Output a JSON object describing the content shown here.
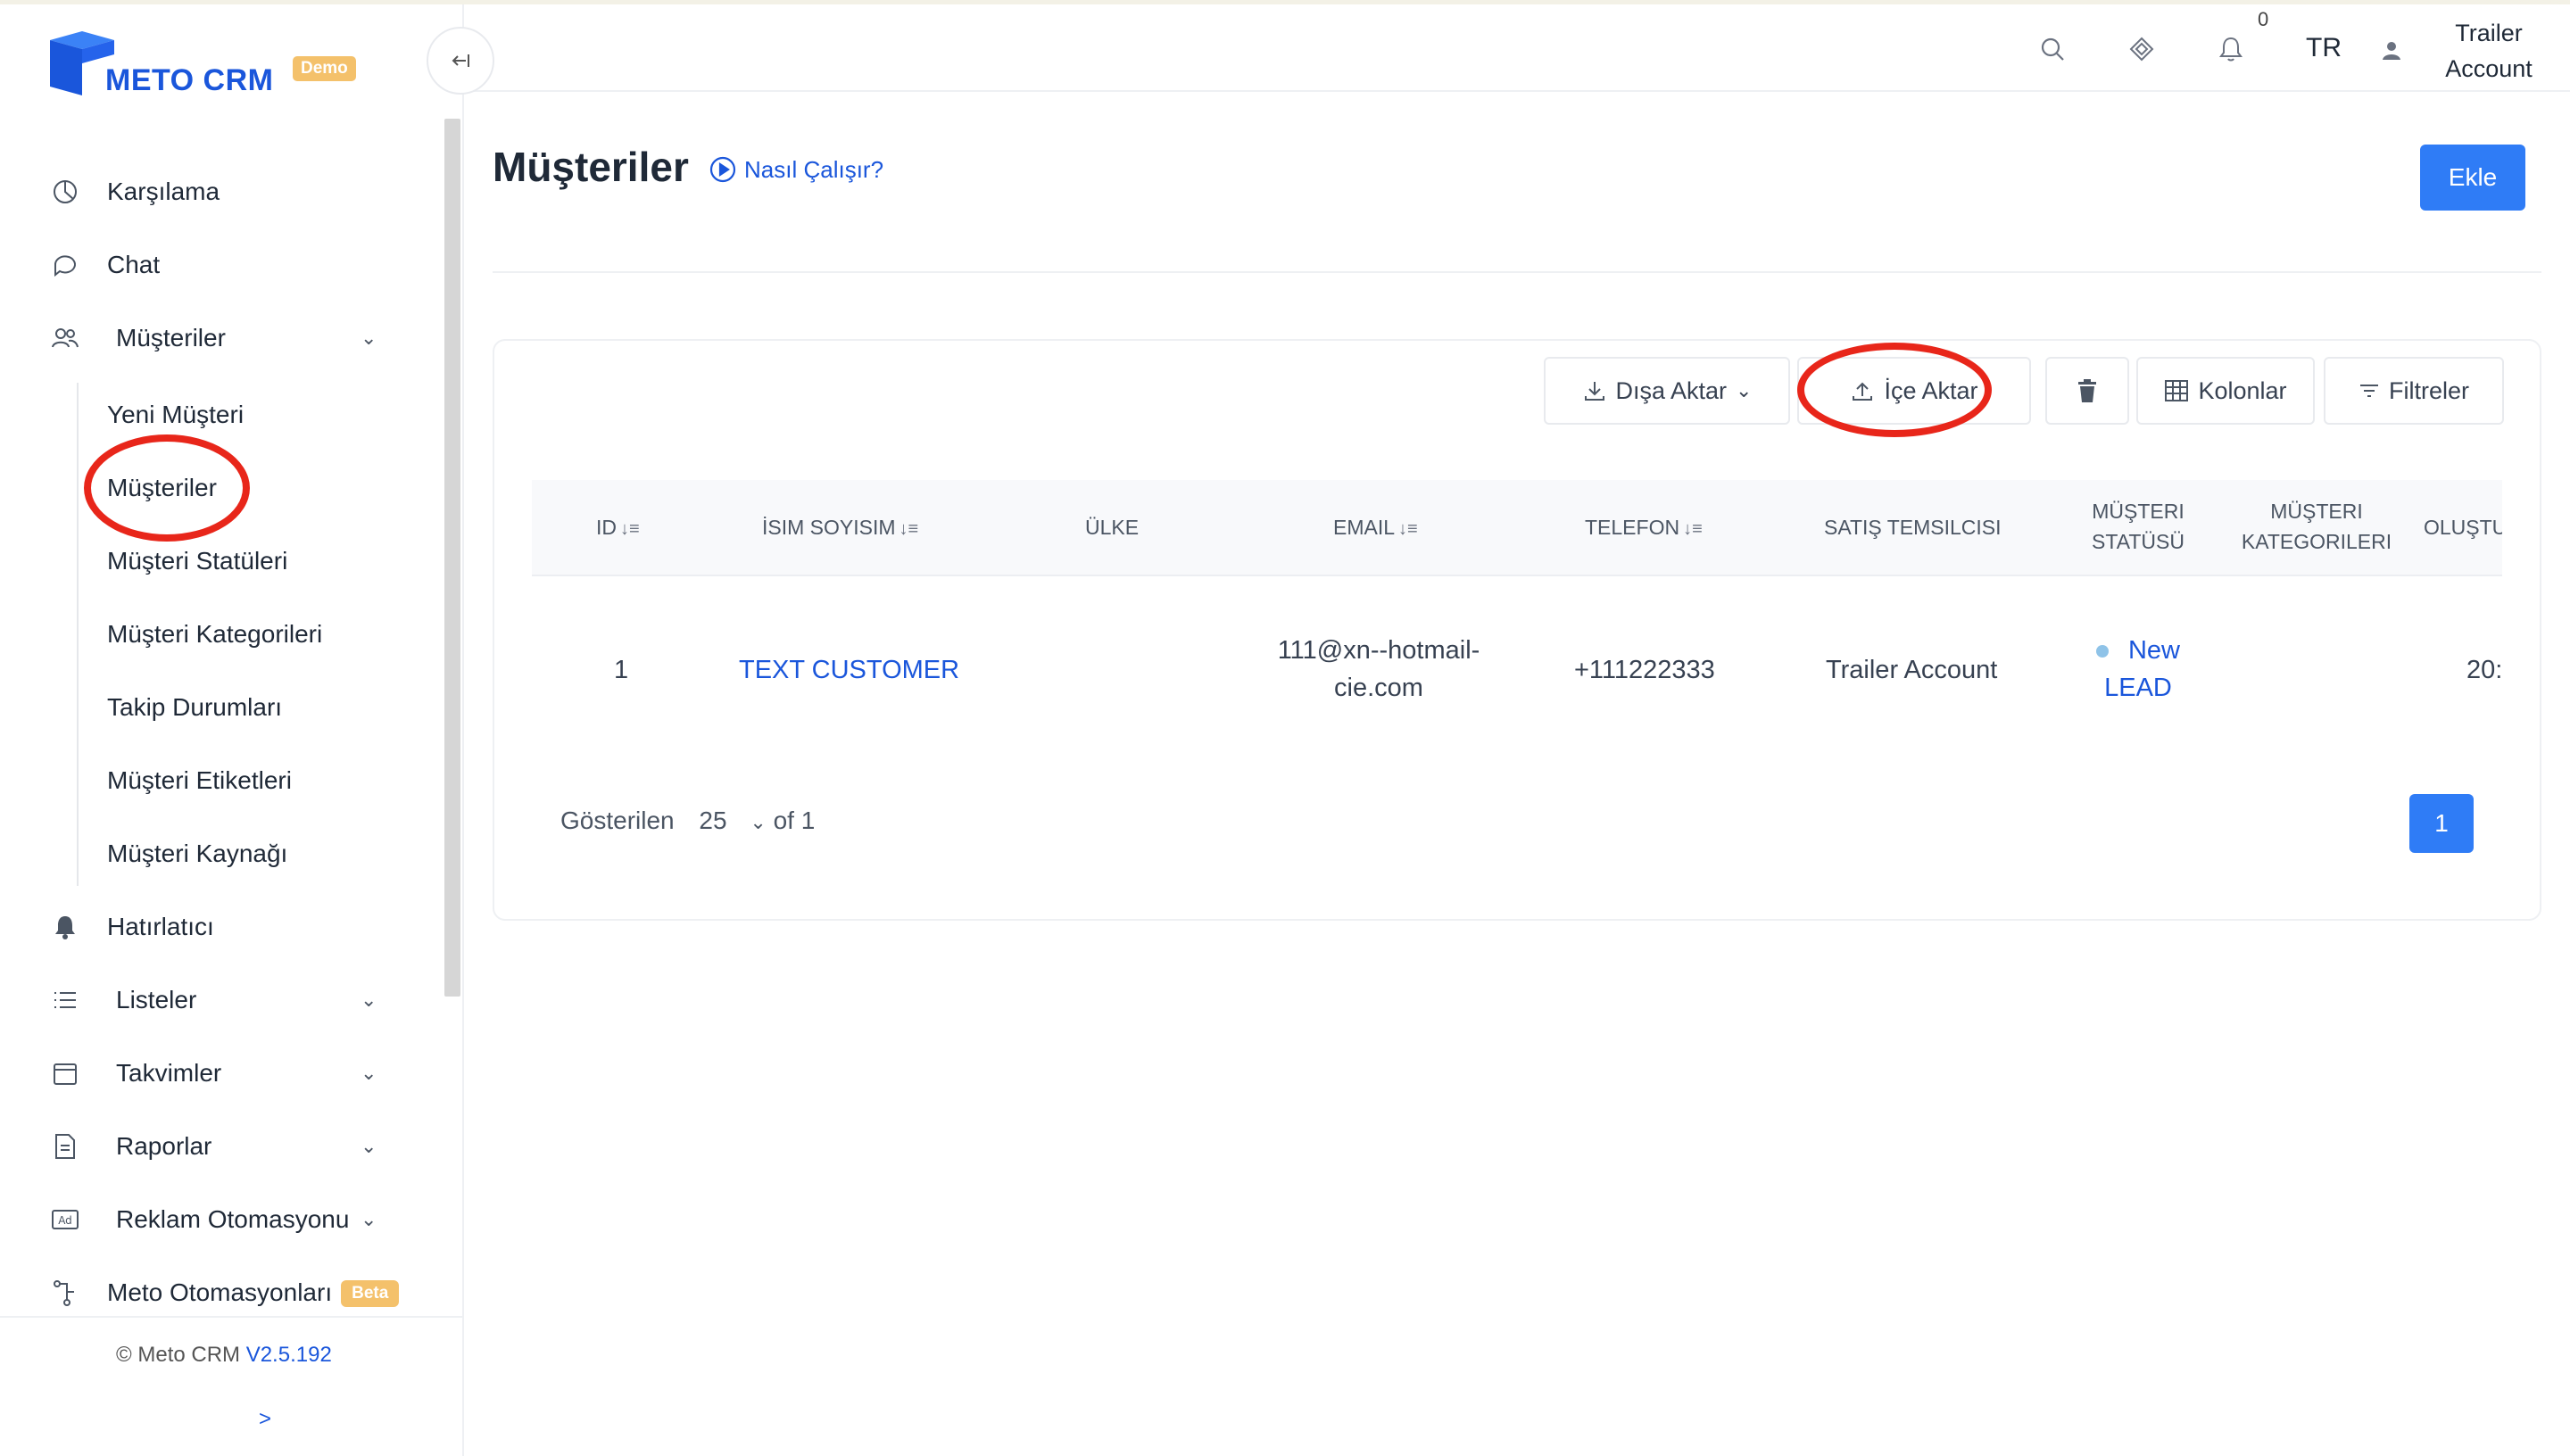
{
  "app": {
    "brand": "METO CRM",
    "badge": "Demo"
  },
  "sidebar": {
    "items": [
      {
        "label": "Karşılama",
        "icon": "pie-chart-icon"
      },
      {
        "label": "Chat",
        "icon": "chat-bubble-icon"
      },
      {
        "label": "Müşteriler",
        "icon": "users-icon",
        "expanded": true
      },
      {
        "label": "Hatırlatıcı",
        "icon": "bell-icon"
      },
      {
        "label": "Listeler",
        "icon": "list-icon"
      },
      {
        "label": "Takvimler",
        "icon": "calendar-icon"
      },
      {
        "label": "Raporlar",
        "icon": "document-icon"
      },
      {
        "label": "Reklam Otomasyonu",
        "icon": "ad-icon"
      },
      {
        "label": "Meto Otomasyonları",
        "icon": "flow-icon",
        "badge": "Beta"
      }
    ],
    "sub_items": [
      "Yeni Müşteri",
      "Müşteriler",
      "Müşteri Statüleri",
      "Müşteri Kategorileri",
      "Takip Durumları",
      "Müşteri Etiketleri",
      "Müşteri Kaynağı"
    ],
    "footer": {
      "copyright": "© Meto CRM",
      "version": "V2.5.192",
      "expand": ">"
    }
  },
  "topbar": {
    "notification_count": "0",
    "language": "TR",
    "user_line1": "Trailer",
    "user_line2": "Account"
  },
  "page": {
    "title": "Müşteriler",
    "howto": "Nasıl Çalışır?",
    "add_button": "Ekle"
  },
  "toolbar": {
    "export": "Dışa Aktar",
    "import": "İçe Aktar",
    "columns": "Kolonlar",
    "filters": "Filtreler"
  },
  "table": {
    "headers": {
      "id": "ID",
      "name": "İSIM SOYISIM",
      "country": "ÜLKE",
      "email": "EMAIL",
      "phone": "TELEFON",
      "sales_rep": "SATIŞ TEMSILCISI",
      "status_l1": "MÜŞTERI",
      "status_l2": "STATÜSÜ",
      "category_l1": "MÜŞTERI",
      "category_l2": "KATEGORILERI",
      "created": "OLUŞTU"
    },
    "rows": [
      {
        "id": "1",
        "name": "TEXT CUSTOMER",
        "country": "",
        "email_l1": "111@xn--hotmail-",
        "email_l2": "cie.com",
        "phone": "+111222333",
        "sales_rep": "Trailer Account",
        "status_l1": "New",
        "status_l2": "LEAD",
        "category": "",
        "created": "20:"
      }
    ]
  },
  "pagination": {
    "shown_label": "Gösterilen",
    "page_size": "25",
    "of_label": "of 1",
    "current_page": "1"
  },
  "colors": {
    "primary": "#2f7cf6",
    "brand": "#1a56db",
    "annotation": "#e8261a",
    "badge": "#f4c16b"
  }
}
